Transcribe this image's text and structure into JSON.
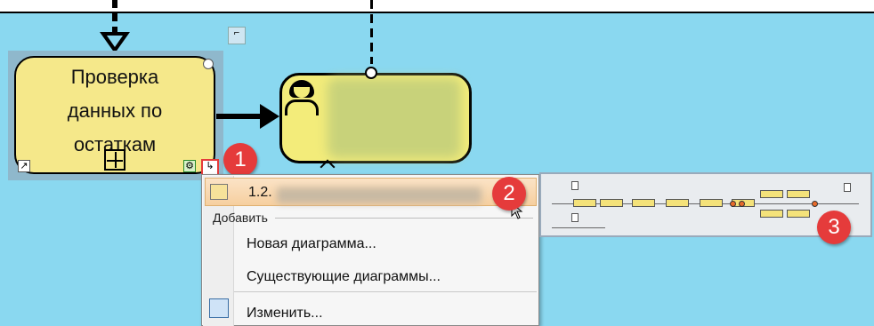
{
  "diagram": {
    "subprocess": {
      "label_lines": [
        "Проверка",
        "данных по",
        "остаткам"
      ]
    },
    "user_task": {
      "label": ""
    }
  },
  "badges": [
    "1",
    "2",
    "3"
  ],
  "context_menu": {
    "item_current": "1.2.",
    "section_label": "Добавить",
    "item_new": "Новая диаграмма...",
    "item_existing": "Существующие диаграммы...",
    "item_edit": "Изменить..."
  },
  "icons": [
    "subprocess-marker-icon",
    "link-icon",
    "gear-icon",
    "drilldown-icon",
    "user-icon",
    "diagram-icon",
    "edit-icon"
  ]
}
